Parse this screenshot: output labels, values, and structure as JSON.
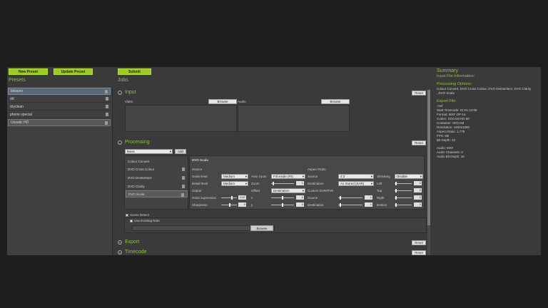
{
  "top": {
    "new_preset": "New Preset",
    "update_preset": "Update Preset",
    "submit": "Submit"
  },
  "presets": {
    "title": "Presets",
    "items": [
      "bitsaver",
      "dd",
      "dryclean",
      "phone special",
      "Unsatic HD"
    ]
  },
  "jobs": {
    "title": "Jobs",
    "input": {
      "title": "Input",
      "reset": "Reset",
      "video": "Video",
      "audio": "Audio",
      "browse": "Browse"
    },
    "processing": {
      "title": "Processing",
      "reset": "Reset",
      "mode": "Basic",
      "add": "Add",
      "ops": [
        "Colour Convert",
        "DVO Cross Colour",
        "DVO Deinterlace",
        "DVO Clarity",
        "DVO Scala"
      ],
      "panel": {
        "title": "DVO Scala",
        "source_h": "Source",
        "aspect_h": "Aspect Ratio",
        "grain_level": "Grain level",
        "grain_level_v": "Medium",
        "detail_level": "Detail level",
        "detail_level_v": "Medium",
        "output": "Output",
        "grain_supp": "Grain supression",
        "grain_supp_v": "0.67",
        "sharpness": "Sharpness",
        "sharpness_v": "0",
        "auto_zoom": "Auto zoom",
        "auto_zoom_v": "Fill inside (Fit)",
        "zoom": "Zoom",
        "zoom_v": "1",
        "offset": "Offset",
        "offset_v": "Destination",
        "x": "x",
        "x_v": "0",
        "y": "y",
        "y_v": "0",
        "source": "Source",
        "source_v": "4:3",
        "destination": "Destination",
        "destination_v": "As Stored (SAR)",
        "custom_dar": "Custom DAR/PAR",
        "c_source": "Source",
        "c_source_v": "1",
        "c_destination": "Destination",
        "c_destination_v": "1",
        "shrinking": "Shrinking",
        "shrinking_v": "Disable",
        "left": "Left",
        "left_v": "0",
        "top": "Top",
        "top_v": "0",
        "right": "Right",
        "right_v": "0",
        "bottom": "Bottom",
        "bottom_v": "0"
      },
      "scene_detect": "Scene Detect",
      "use_existing": "Use Existing Note",
      "browse": "Browse"
    },
    "export": {
      "title": "Export",
      "reset": "Reset"
    },
    "timecode": {
      "title": "Timecode",
      "reset": "Reset"
    }
  },
  "summary": {
    "title": "Summary",
    "input_info": "Input File Information:",
    "proc_h": "Processing Options:",
    "proc_1": "Colour Convert, DVO Cross Colour, DVO Deinterlace, DVO Clarity",
    "proc_2": ", DVO Scala",
    "export_h": "Export File:",
    "lines": [
      ".mxf",
      "Start Timecode: 01:01:13:06",
      "Format: MXF OP-1a",
      "Codec: XDCAM HD 50",
      "Container: XDCAM",
      "Resolution: 1920x1080",
      "Aspect Ratio: 1.778",
      "FPS: 59i",
      "Bit Depth: 10"
    ],
    "audio": [
      "Audio: MXF",
      "Audio Channels: 8",
      "Audio Bit Depth: 16"
    ]
  }
}
